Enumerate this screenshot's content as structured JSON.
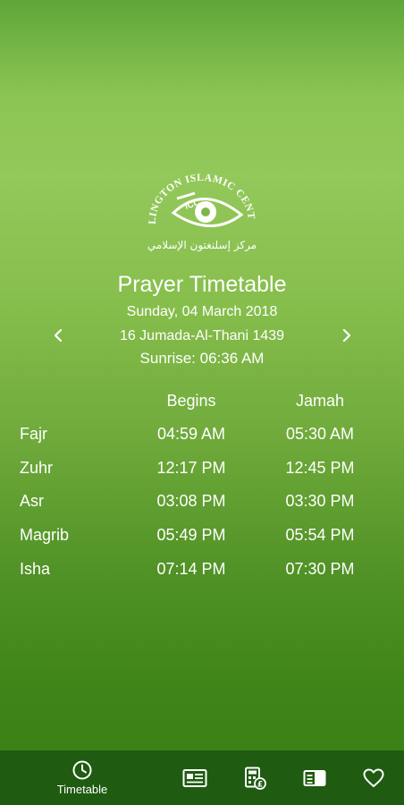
{
  "header": {
    "logo_text_top": "ISLINGTON ISLAMIC CENTRE",
    "logo_initials": "ICC",
    "logo_text_arabic": "مركز إسلنغتون الإسلامي",
    "title": "Prayer Timetable",
    "gregorian_date": "Sunday, 04 March 2018",
    "hijri_date": "16 Jumada-Al-Thani 1439",
    "sunrise": "Sunrise: 06:36 AM",
    "prev_icon": "chevron-left-icon",
    "next_icon": "chevron-right-icon"
  },
  "table": {
    "headers": {
      "begins": "Begins",
      "jamah": "Jamah"
    },
    "rows": [
      {
        "name": "Fajr",
        "begins": "04:59 AM",
        "jamah": "05:30 AM"
      },
      {
        "name": "Zuhr",
        "begins": "12:17 PM",
        "jamah": "12:45 PM"
      },
      {
        "name": "Asr",
        "begins": "03:08 PM",
        "jamah": "03:30 PM"
      },
      {
        "name": "Magrib",
        "begins": "05:49 PM",
        "jamah": "05:54 PM"
      },
      {
        "name": "Isha",
        "begins": "07:14 PM",
        "jamah": "07:30 PM"
      }
    ]
  },
  "bottom_nav": {
    "items": [
      {
        "label": "Timetable",
        "icon": "clock-icon"
      },
      {
        "icon": "newspaper-icon"
      },
      {
        "icon": "calculator-icon"
      },
      {
        "icon": "book-icon"
      },
      {
        "icon": "heart-icon"
      }
    ]
  },
  "colors": {
    "bar": "#1f5b10",
    "text": "#ffffff"
  }
}
